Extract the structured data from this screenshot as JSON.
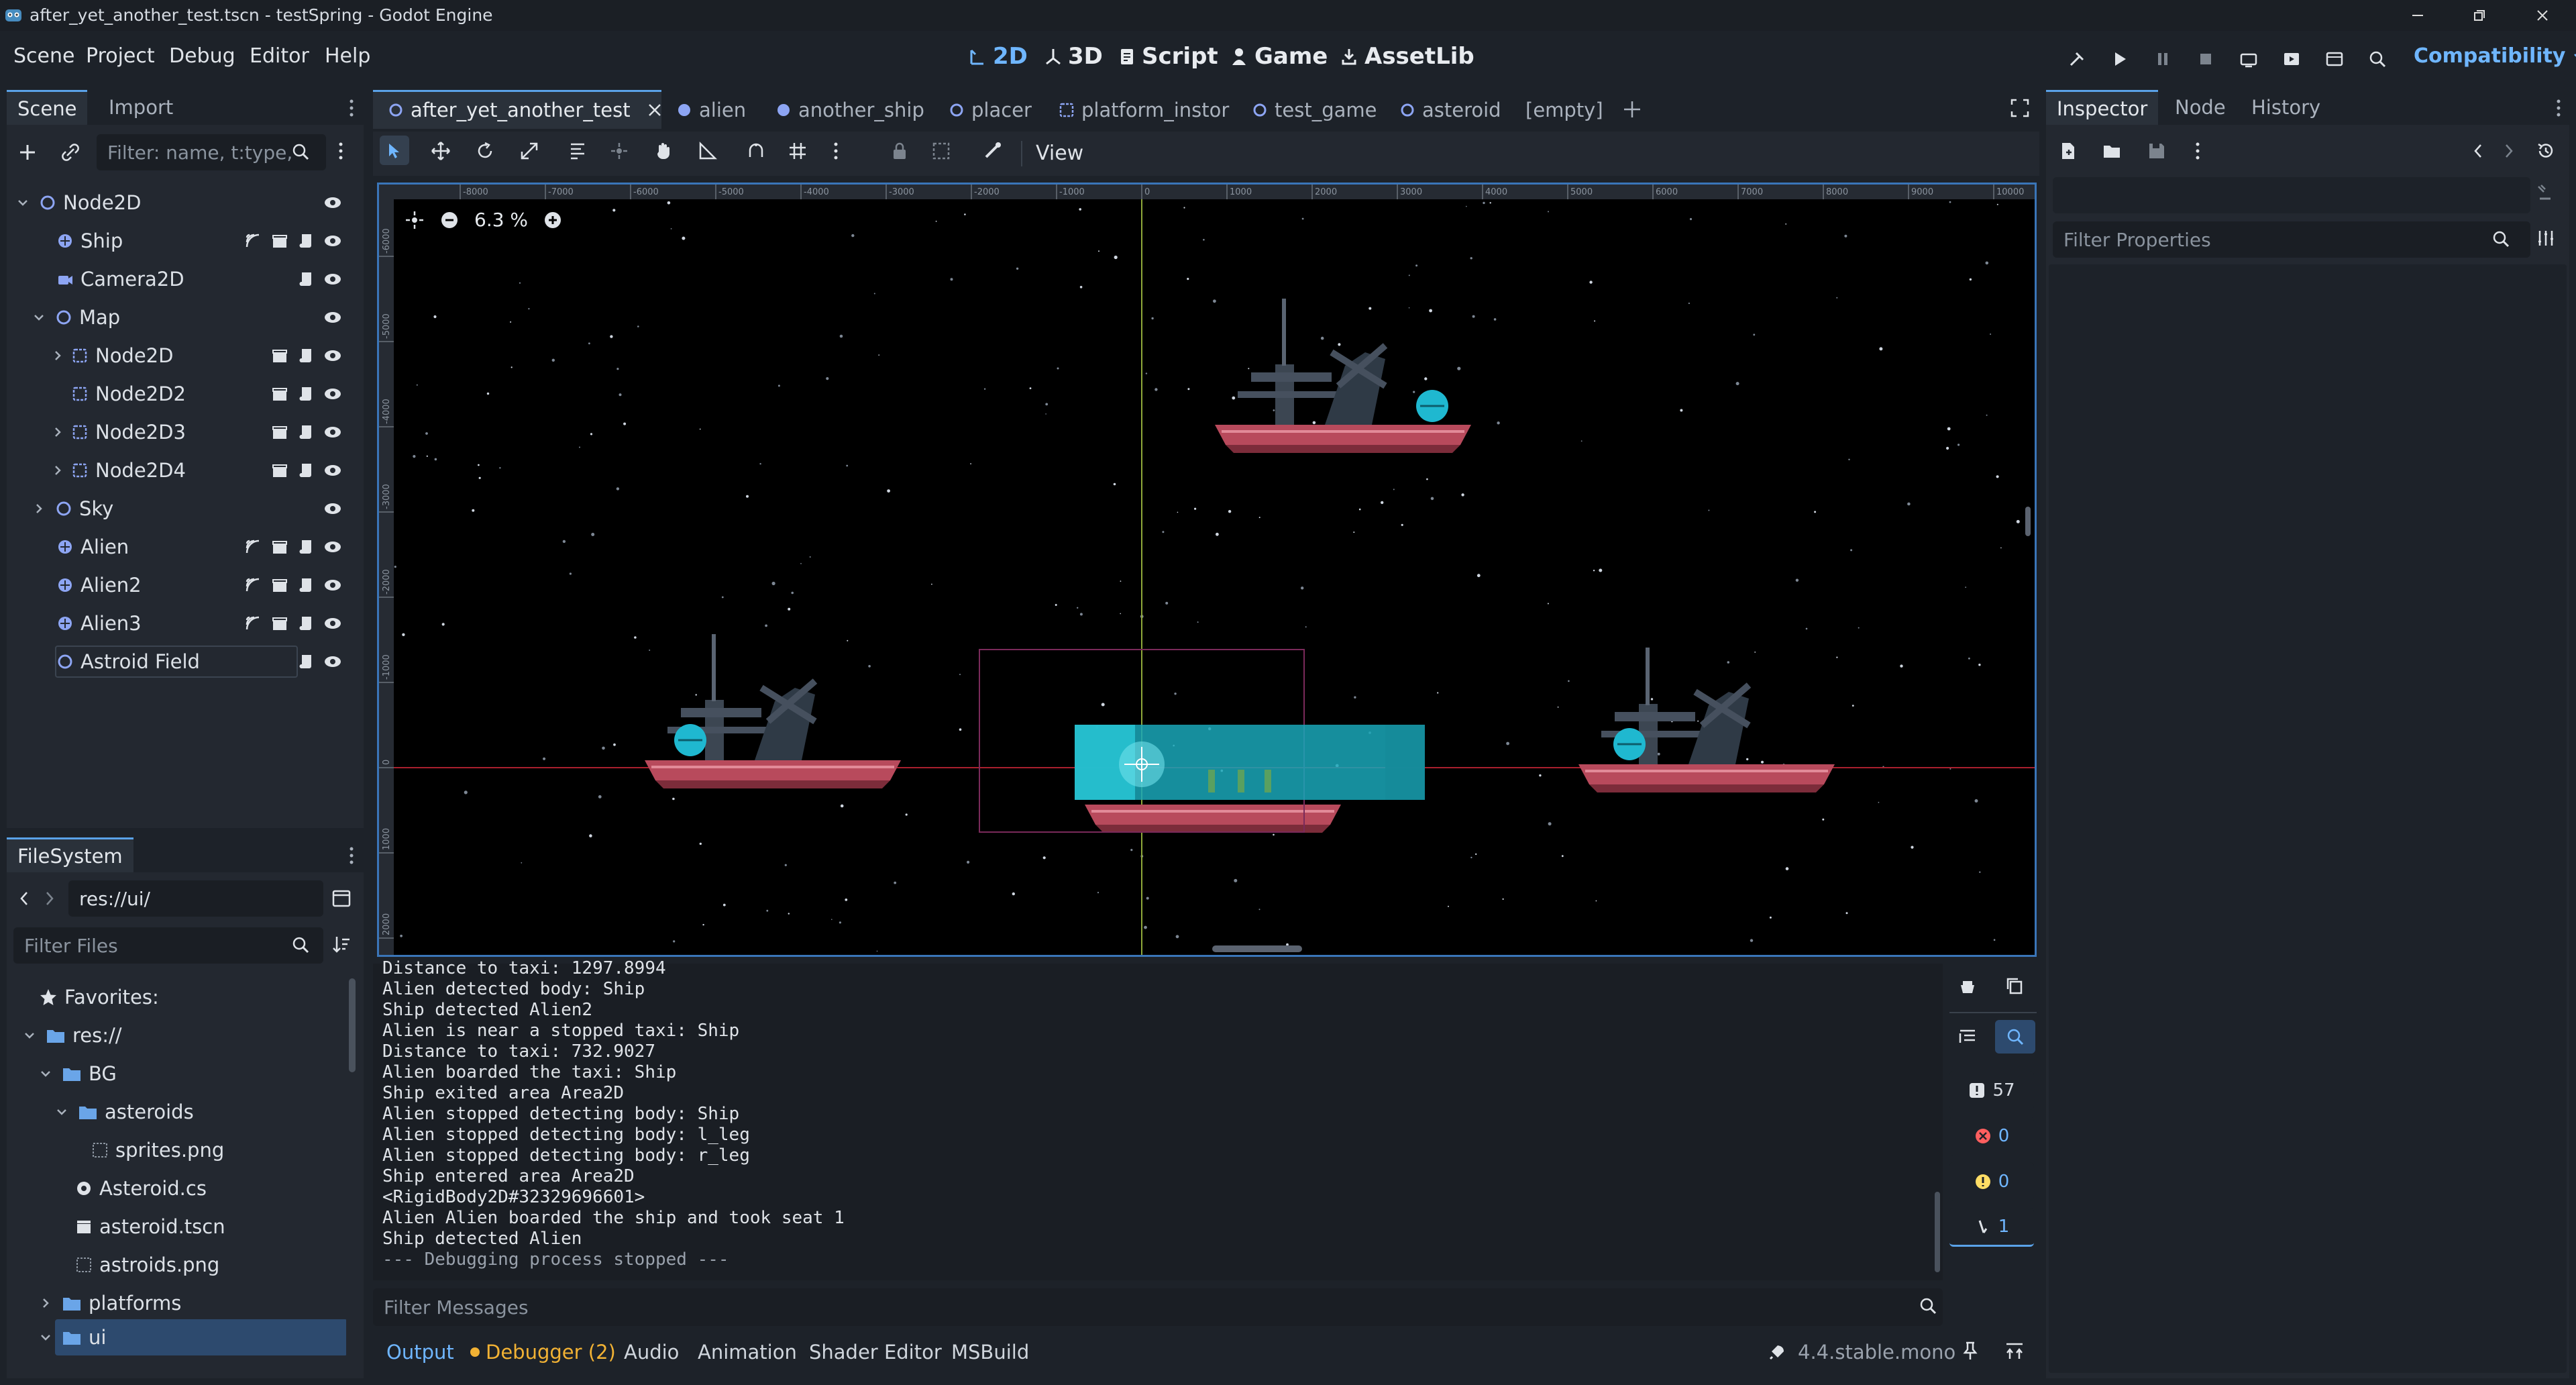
{
  "window": {
    "title": "after_yet_another_test.tscn - testSpring - Godot Engine"
  },
  "menu": [
    "Scene",
    "Project",
    "Debug",
    "Editor",
    "Help"
  ],
  "workspaces": [
    {
      "label": "2D",
      "icon": "2d-icon",
      "active": true
    },
    {
      "label": "3D",
      "icon": "3d-icon"
    },
    {
      "label": "Script",
      "icon": "script-icon"
    },
    {
      "label": "Game",
      "icon": "game-icon"
    },
    {
      "label": "AssetLib",
      "icon": "assetlib-icon"
    }
  ],
  "renderer": "Compatibility",
  "scene_dock": {
    "tabs": [
      "Scene",
      "Import"
    ],
    "filter_placeholder": "Filter: name, t:type,",
    "nodes": [
      {
        "name": "Node2D",
        "icon": "node2d-icon"
      },
      {
        "name": "Ship",
        "icon": "rigidbody-icon"
      },
      {
        "name": "Camera2D",
        "icon": "camera-icon"
      },
      {
        "name": "Map",
        "icon": "node2d-icon"
      },
      {
        "name": "Node2D",
        "icon": "instance-icon"
      },
      {
        "name": "Node2D2",
        "icon": "instance-icon"
      },
      {
        "name": "Node2D3",
        "icon": "instance-icon"
      },
      {
        "name": "Node2D4",
        "icon": "instance-icon"
      },
      {
        "name": "Sky",
        "icon": "node2d-icon"
      },
      {
        "name": "Alien",
        "icon": "rigidbody-icon"
      },
      {
        "name": "Alien2",
        "icon": "rigidbody-icon"
      },
      {
        "name": "Alien3",
        "icon": "rigidbody-icon"
      },
      {
        "name": "Astroid Field",
        "icon": "node2d-icon"
      }
    ]
  },
  "filesystem": {
    "tab": "FileSystem",
    "path": "res://ui/",
    "filter_placeholder": "Filter Files",
    "items": [
      {
        "label": "Favorites:",
        "icon": "star-icon"
      },
      {
        "label": "res://",
        "icon": "folder-icon"
      },
      {
        "label": "BG",
        "icon": "folder-icon"
      },
      {
        "label": "asteroids",
        "icon": "folder-icon"
      },
      {
        "label": "sprites.png",
        "icon": "image-icon"
      },
      {
        "label": "Asteroid.cs",
        "icon": "csharp-icon"
      },
      {
        "label": "asteroid.tscn",
        "icon": "scene-icon"
      },
      {
        "label": "astroids.png",
        "icon": "image-icon"
      },
      {
        "label": "platforms",
        "icon": "folder-icon"
      },
      {
        "label": "ui",
        "icon": "folder-icon",
        "selected": true
      }
    ]
  },
  "editor_tabs": [
    {
      "label": "after_yet_another_test",
      "active": true
    },
    {
      "label": "alien"
    },
    {
      "label": "another_ship"
    },
    {
      "label": "placer"
    },
    {
      "label": "platform_instor"
    },
    {
      "label": "test_game"
    },
    {
      "label": "asteroid"
    },
    {
      "label": "[empty]"
    }
  ],
  "toolbar": {
    "view_label": "View"
  },
  "viewport": {
    "zoom": "6.3 %"
  },
  "ruler": {
    "x_labels": [
      "-8000",
      "-7000",
      "-6000",
      "-5000",
      "-4000",
      "-3000",
      "-2000",
      "-1000",
      "0",
      "1000",
      "2000",
      "3000",
      "4000",
      "5000",
      "6000",
      "7000",
      "8000",
      "9000",
      "10000"
    ],
    "y_labels": [
      "-6000",
      "-5000",
      "-4000",
      "-3000",
      "-2000",
      "-1000",
      "0",
      "1000",
      "2000"
    ]
  },
  "output": {
    "lines": [
      "Distance to taxi: 1297.8994",
      "Alien detected body: Ship",
      "Ship detected Alien2",
      "Alien is near a stopped taxi: Ship",
      "Distance to taxi: 732.9027",
      "Alien boarded the taxi: Ship",
      "Ship exited area Area2D",
      "Alien stopped detecting body: Ship",
      "Alien stopped detecting body: l_leg",
      "Alien stopped detecting body: r_leg",
      "Ship entered area Area2D",
      "<RigidBody2D#32329696601>",
      "Alien Alien boarded the ship and took seat 1",
      "Ship detected Alien",
      "--- Debugging process stopped ---"
    ],
    "filter_placeholder": "Filter Messages",
    "counters": {
      "messages": "57",
      "errors": "0",
      "warnings": "0",
      "editor": "1"
    }
  },
  "bottom_tabs": [
    "Output",
    "Debugger (2)",
    "Audio",
    "Animation",
    "Shader Editor",
    "MSBuild"
  ],
  "version": "4.4.stable.mono",
  "inspector": {
    "tabs": [
      "Inspector",
      "Node",
      "History"
    ],
    "filter_placeholder": "Filter Properties"
  },
  "colors": {
    "accent": "#6fb6ff",
    "debugger_dot": "#f2b234",
    "error": "#ff5f5f",
    "warning": "#ffdd65"
  }
}
